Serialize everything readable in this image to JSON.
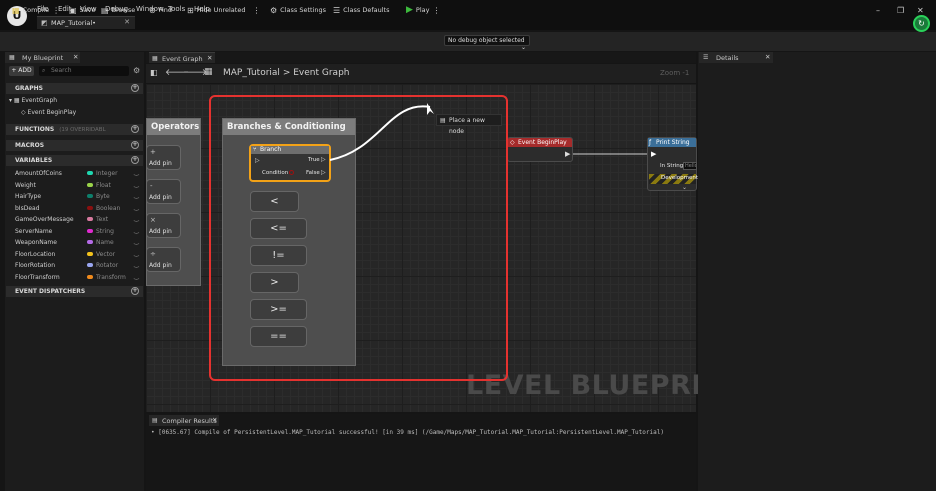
{
  "app": {
    "logo": "U",
    "document_tab": "MAP_Tutorial•"
  },
  "menu": [
    "File",
    "Edit",
    "View",
    "Debug",
    "Window",
    "Tools",
    "Help"
  ],
  "window_controls": {
    "minimize": "–",
    "restore": "❐",
    "close": "✕"
  },
  "toolbar": {
    "compile": "Compile",
    "save": "Save",
    "browse": "Browse",
    "find": "Find",
    "hide_unrelated": "Hide Unrelated",
    "class_settings": "Class Settings",
    "class_defaults": "Class Defaults",
    "play": "Play",
    "debug_object": "No debug object selected"
  },
  "left_panel": {
    "tab_title": "My Blueprint",
    "add_label": "+ ADD",
    "search_placeholder": "Search",
    "graphs_header": "GRAPHS",
    "event_graph": "EventGraph",
    "event_begin_play": "Event BeginPlay",
    "functions_header": "FUNCTIONS",
    "functions_overridable": "(19 OVERRIDABL",
    "macros_header": "MACROS",
    "variables_header": "VARIABLES",
    "variables": [
      {
        "name": "AmountOfCoins",
        "type": "Integer",
        "color": "#1fd7b0"
      },
      {
        "name": "Weight",
        "type": "Float",
        "color": "#9ad34a"
      },
      {
        "name": "HairType",
        "type": "Byte",
        "color": "#0d7f6b"
      },
      {
        "name": "bIsDead",
        "type": "Boolean",
        "color": "#8b1010"
      },
      {
        "name": "GameOverMessage",
        "type": "Text",
        "color": "#d87aa0"
      },
      {
        "name": "ServerName",
        "type": "String",
        "color": "#e02bd0"
      },
      {
        "name": "WeaponName",
        "type": "Name",
        "color": "#b56be6"
      },
      {
        "name": "FloorLocation",
        "type": "Vector",
        "color": "#f3c21c"
      },
      {
        "name": "FloorRotation",
        "type": "Rotator",
        "color": "#9aa6f0"
      },
      {
        "name": "FloorTransform",
        "type": "Transform",
        "color": "#f08a1c"
      }
    ],
    "event_dispatchers_header": "EVENT DISPATCHERS"
  },
  "graph": {
    "tab_title": "Event Graph",
    "breadcrumb_root": "MAP_Tutorial",
    "breadcrumb_sep": ">",
    "breadcrumb_current": "Event Graph",
    "zoom": "Zoom -1",
    "watermark": "LEVEL BLUEPRINT",
    "tooltip": "Place a new node",
    "operators_title": "Operators",
    "add_pin": "Add pin",
    "operator_symbols": [
      "+",
      "-",
      "×",
      "÷"
    ],
    "branches_title": "Branches & Conditioning",
    "branch_node": {
      "title": "Branch",
      "condition": "Condition",
      "true_label": "True",
      "false_label": "False"
    },
    "comparison_nodes": [
      "<",
      "<=",
      "!=",
      ">",
      ">=",
      "=="
    ],
    "event_node": "Event BeginPlay",
    "print_node": {
      "title": "Print String",
      "in_string": "In String",
      "in_string_value": "Hello",
      "development": "Development"
    }
  },
  "details_panel": {
    "tab_title": "Details"
  },
  "compiler": {
    "tab_title": "Compiler Results",
    "message": "[0635.67] Compile of PersistentLevel.MAP_Tutorial successful! [in 39 ms] (/Game/Maps/MAP_Tutorial.MAP_Tutorial:PersistentLevel.MAP_Tutorial)"
  }
}
